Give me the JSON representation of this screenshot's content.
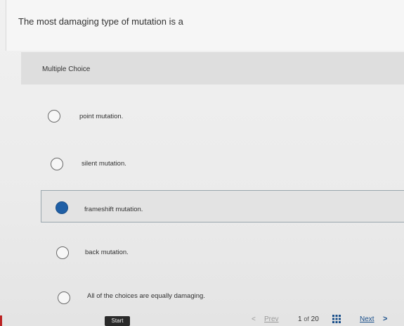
{
  "question": {
    "text": "The most damaging type of mutation is a"
  },
  "question_type": "Multiple Choice",
  "choices": [
    {
      "label": "point mutation.",
      "selected": false
    },
    {
      "label": "silent mutation.",
      "selected": false
    },
    {
      "label": "frameshift mutation.",
      "selected": true
    },
    {
      "label": "back mutation.",
      "selected": false
    },
    {
      "label": "All of the choices are equally damaging.",
      "selected": false
    }
  ],
  "footer": {
    "start_label": "Start",
    "prev_label": "Prev",
    "prev_arrow": "<",
    "current_page": "1",
    "of_label": "of",
    "total_pages": "20",
    "next_label": "Next",
    "next_arrow": ">"
  },
  "colors": {
    "selected_radio": "#1f5fa6",
    "link": "#1a4f8a"
  }
}
